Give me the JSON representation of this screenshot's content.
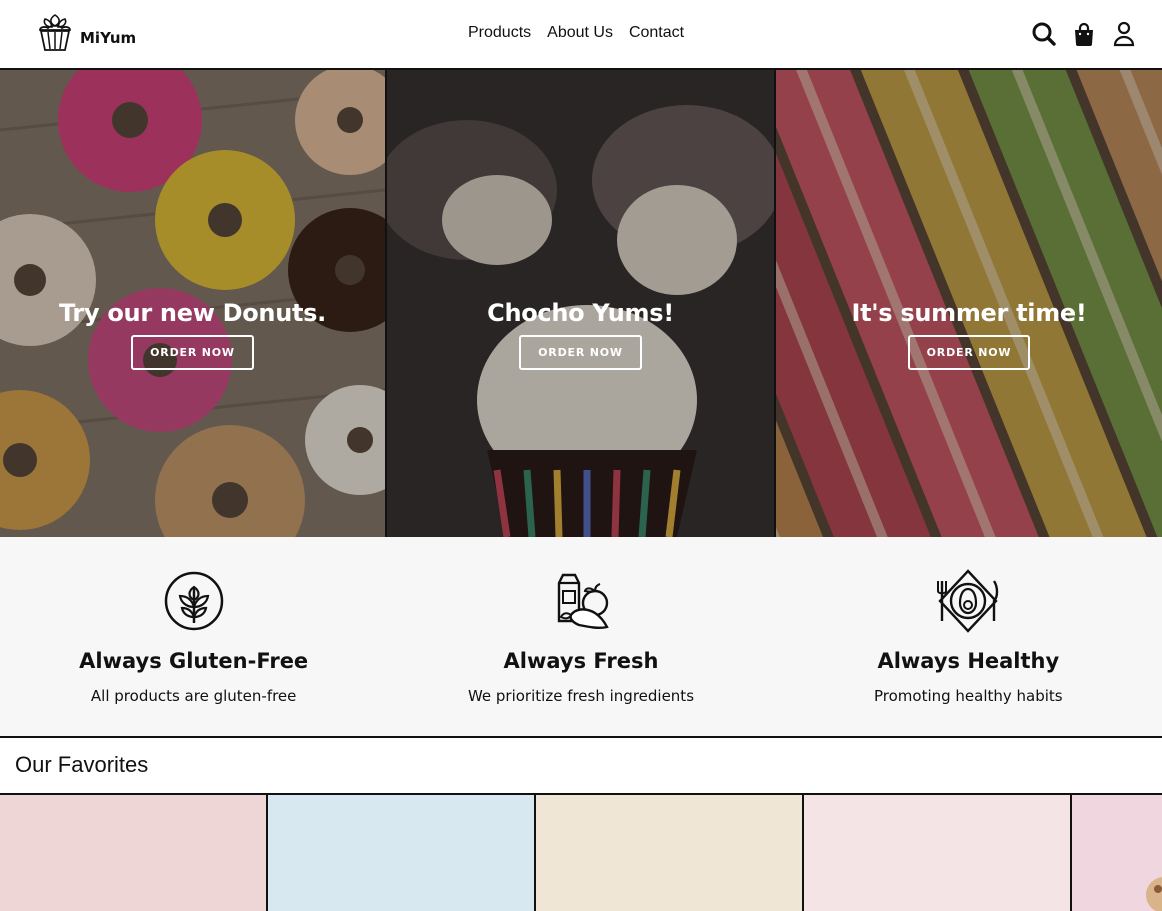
{
  "header": {
    "logo_text": "MiYum",
    "nav": [
      {
        "label": "Products"
      },
      {
        "label": "About Us"
      },
      {
        "label": "Contact"
      }
    ],
    "icons": [
      "search-icon",
      "shopping-bag-icon",
      "user-icon"
    ]
  },
  "hero": {
    "panels": [
      {
        "title": "Try our new Donuts.",
        "button": "ORDER NOW",
        "image": "donuts"
      },
      {
        "title": "Chocho Yums!",
        "button": "ORDER NOW",
        "image": "cupcakes"
      },
      {
        "title": "It's summer time!",
        "button": "ORDER NOW",
        "image": "macarons"
      }
    ]
  },
  "features": [
    {
      "title": "Always Gluten-Free",
      "text": "All products are gluten-free",
      "icon": "leaf-badge-icon"
    },
    {
      "title": "Always Fresh",
      "text": "We prioritize fresh ingredients",
      "icon": "grocery-icon"
    },
    {
      "title": "Always Healthy",
      "text": "Promoting healthy habits",
      "icon": "avocado-plate-icon"
    }
  ],
  "favorites": {
    "title": "Our Favorites",
    "cards": [
      {
        "color": "#eed6d7"
      },
      {
        "color": "#d8e8f1"
      },
      {
        "color": "#f0e6d6"
      },
      {
        "color": "#f5e4e6"
      },
      {
        "color": "#efd6df"
      }
    ]
  }
}
